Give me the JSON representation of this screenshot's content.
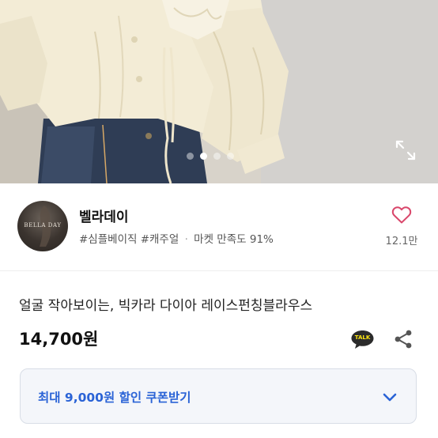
{
  "hero": {
    "slide_count": 4,
    "active_slide": 2,
    "expand_icon": "expand-icon"
  },
  "shop": {
    "logo_text": "BELLA DAY",
    "name": "벨라데이",
    "tags": "#심플베이직 #캐주얼",
    "separator": "·",
    "satisfaction": "마켓 만족도 91%",
    "like_icon": "heart-icon",
    "like_count": "12.1만"
  },
  "product": {
    "title": "얼굴 작아보이는, 빅카라 다이아 레이스펀칭블라우스",
    "price": "14,700원",
    "talk_label": "TALK",
    "share_icon": "share-icon"
  },
  "coupon": {
    "label": "최대 9,000원 할인 쿠폰받기",
    "chevron_icon": "chevron-down-icon"
  },
  "colors": {
    "accent_blue": "#2a63d6",
    "heart_red": "#d9476b",
    "talk_yellow": "#ffe812",
    "coupon_bg": "#f4f6fa"
  }
}
